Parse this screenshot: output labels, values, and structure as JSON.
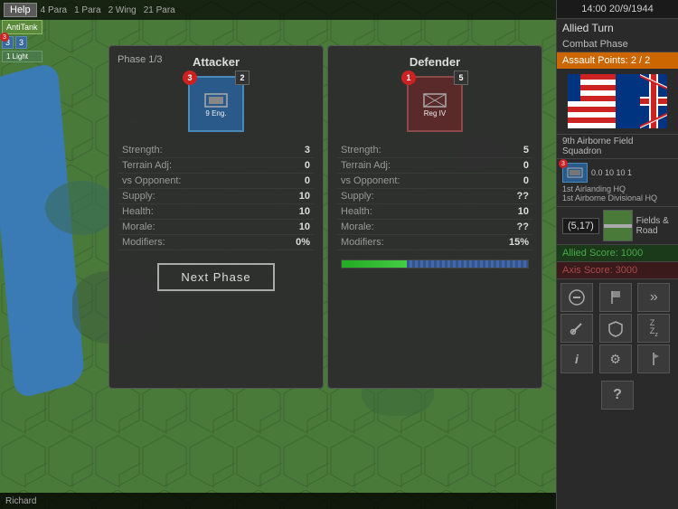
{
  "header": {
    "help_label": "Help",
    "time": "14:00 20/9/1944"
  },
  "top_units": {
    "para_labels": [
      "4 Para",
      "1 Para",
      "2 Wing",
      "21 Para"
    ],
    "anti_tank_label": "AntiTank",
    "light_label": "1 Light"
  },
  "sidebar": {
    "time": "14:00 20/9/1944",
    "turn_label": "Allied Turn",
    "phase_label": "Combat Phase",
    "assault_points": "Assault Points: 2 / 2",
    "unit_name": "9th Airborne Field Squadron",
    "coord": "(5,17)",
    "terrain": "Fields & Road",
    "allied_score": "Allied Score: 1000",
    "axis_score": "Axis Score: 3000",
    "unit_detail_1": "1st Airlanding HQ",
    "unit_detail_2": "1st Airborne Divisional HQ",
    "unit_stats": "0.0  10  10  1"
  },
  "combat": {
    "phase_label": "Phase 1/3",
    "attacker": {
      "title": "Attacker",
      "strength_label": "Strength:",
      "strength_value": "3",
      "terrain_adj_label": "Terrain Adj:",
      "terrain_adj_value": "0",
      "vs_opponent_label": "vs Opponent:",
      "vs_opponent_value": "0",
      "supply_label": "Supply:",
      "supply_value": "10",
      "health_label": "Health:",
      "health_value": "10",
      "morale_label": "Morale:",
      "morale_value": "10",
      "modifiers_label": "Modifiers:",
      "modifiers_value": "0%",
      "unit_name": "9 Eng.",
      "corner_red": "3",
      "corner_black": "2"
    },
    "defender": {
      "title": "Defender",
      "strength_label": "Strength:",
      "strength_value": "5",
      "terrain_adj_label": "Terrain Adj:",
      "terrain_adj_value": "0",
      "vs_opponent_label": "vs Opponent:",
      "vs_opponent_value": "0",
      "supply_label": "Supply:",
      "supply_value": "??",
      "health_label": "Health:",
      "health_value": "10",
      "morale_label": "Morale:",
      "morale_value": "??",
      "modifiers_label": "Modifiers:",
      "modifiers_value": "15%",
      "unit_name": "Reg IV",
      "corner_red": "1",
      "corner_black": "5"
    },
    "next_phase_btn": "Next Phase"
  },
  "status_bar": {
    "player": "Richard"
  },
  "buttons": {
    "b1": "⊖",
    "b2": "🏴",
    "b3": "»",
    "b4": "⚒",
    "b5": "🛡",
    "b6": "ZZz",
    "b7": "i",
    "b8": "⚙",
    "b9": "🏳",
    "b10": "?"
  }
}
